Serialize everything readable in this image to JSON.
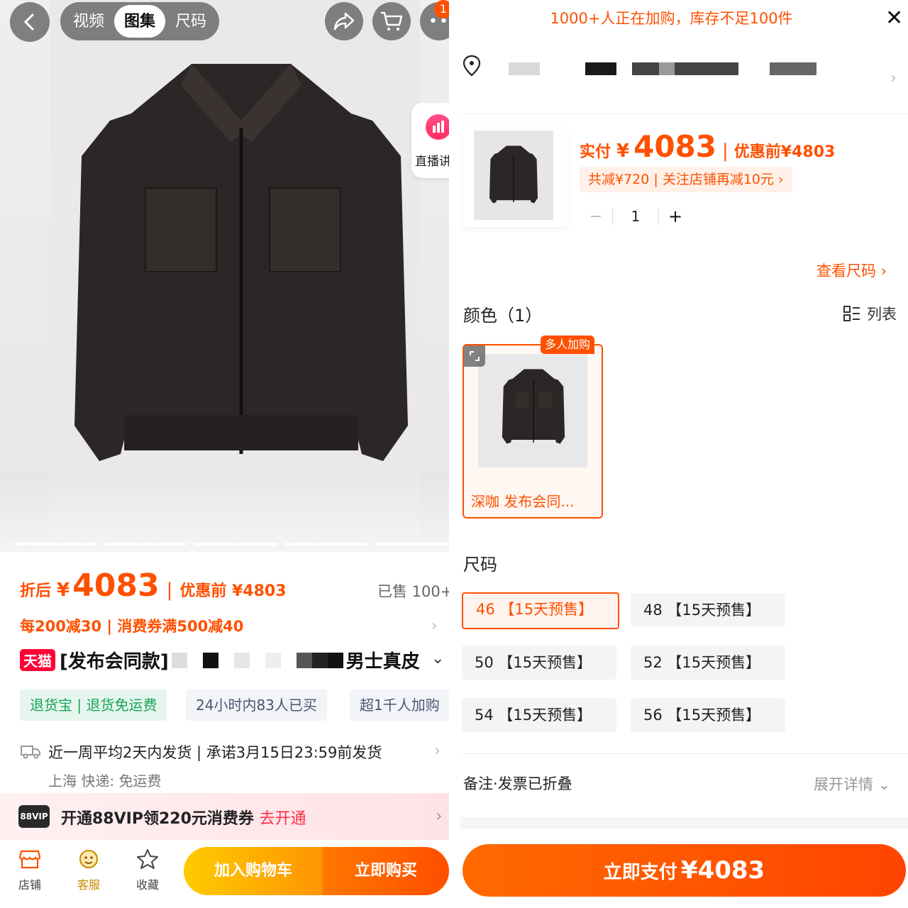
{
  "left": {
    "tabs": [
      "视频",
      "图集",
      "尺码"
    ],
    "active_tab": "图集",
    "cart_badge": "1",
    "live_chip_label": "直播讲",
    "price": {
      "prefix": "折后",
      "yen": "¥",
      "value": "4083",
      "sep": "|",
      "orig_label": "优惠前 ¥4803"
    },
    "sold": "已售 100+",
    "promo": "每200减30 | 消费券满500减40",
    "title": {
      "badge": "天猫",
      "part_a": "[发布会同款]",
      "part_b": "男士真皮"
    },
    "tags": {
      "green": "退货宝 | 退货免运费",
      "grey1": "24小时内83人已买",
      "grey2": "超1千人加购"
    },
    "shipping": {
      "line1": "近一周平均2天内发货 | 承诺3月15日23:59前发货",
      "line2": "上海  快递: 免运费"
    },
    "vip": {
      "logo": "88VIP",
      "text": "开通88VIP领220元消费券",
      "link": "去开通"
    },
    "bottom_nav": {
      "shop": "店铺",
      "service": "客服",
      "fav": "收藏",
      "add_cart": "加入购物车",
      "buy_now": "立即购买"
    }
  },
  "right": {
    "banner": "1000+人正在加购，库存不足100件",
    "pay": {
      "prefix": "实付",
      "yen": "¥",
      "value": "4083",
      "sep": "|",
      "orig_label": "优惠前¥4803"
    },
    "discount_chip": "共减¥720 | 关注店铺再减10元 ›",
    "quantity": "1",
    "size_chart_link": "查看尺码 ›",
    "color_title": "颜色（1）",
    "list_toggle": "列表",
    "hot_badge": "多人加购",
    "color_option_name": "深咖 发布会同...",
    "size_title": "尺码",
    "sizes": [
      "46 【15天预售】",
      "48 【15天预售】",
      "50 【15天预售】",
      "52 【15天预售】",
      "54 【15天预售】",
      "56 【15天预售】"
    ],
    "selected_size": "46 【15天预售】",
    "note_label": "备注·发票已折叠",
    "note_expand": "展开详情 ⌄",
    "pay_button": {
      "label": "立即支付",
      "amount": "¥4083"
    }
  },
  "colors": {
    "accent": "#ff5000",
    "tmall_red": "#ff0036",
    "green_tag": "#19a35b"
  }
}
